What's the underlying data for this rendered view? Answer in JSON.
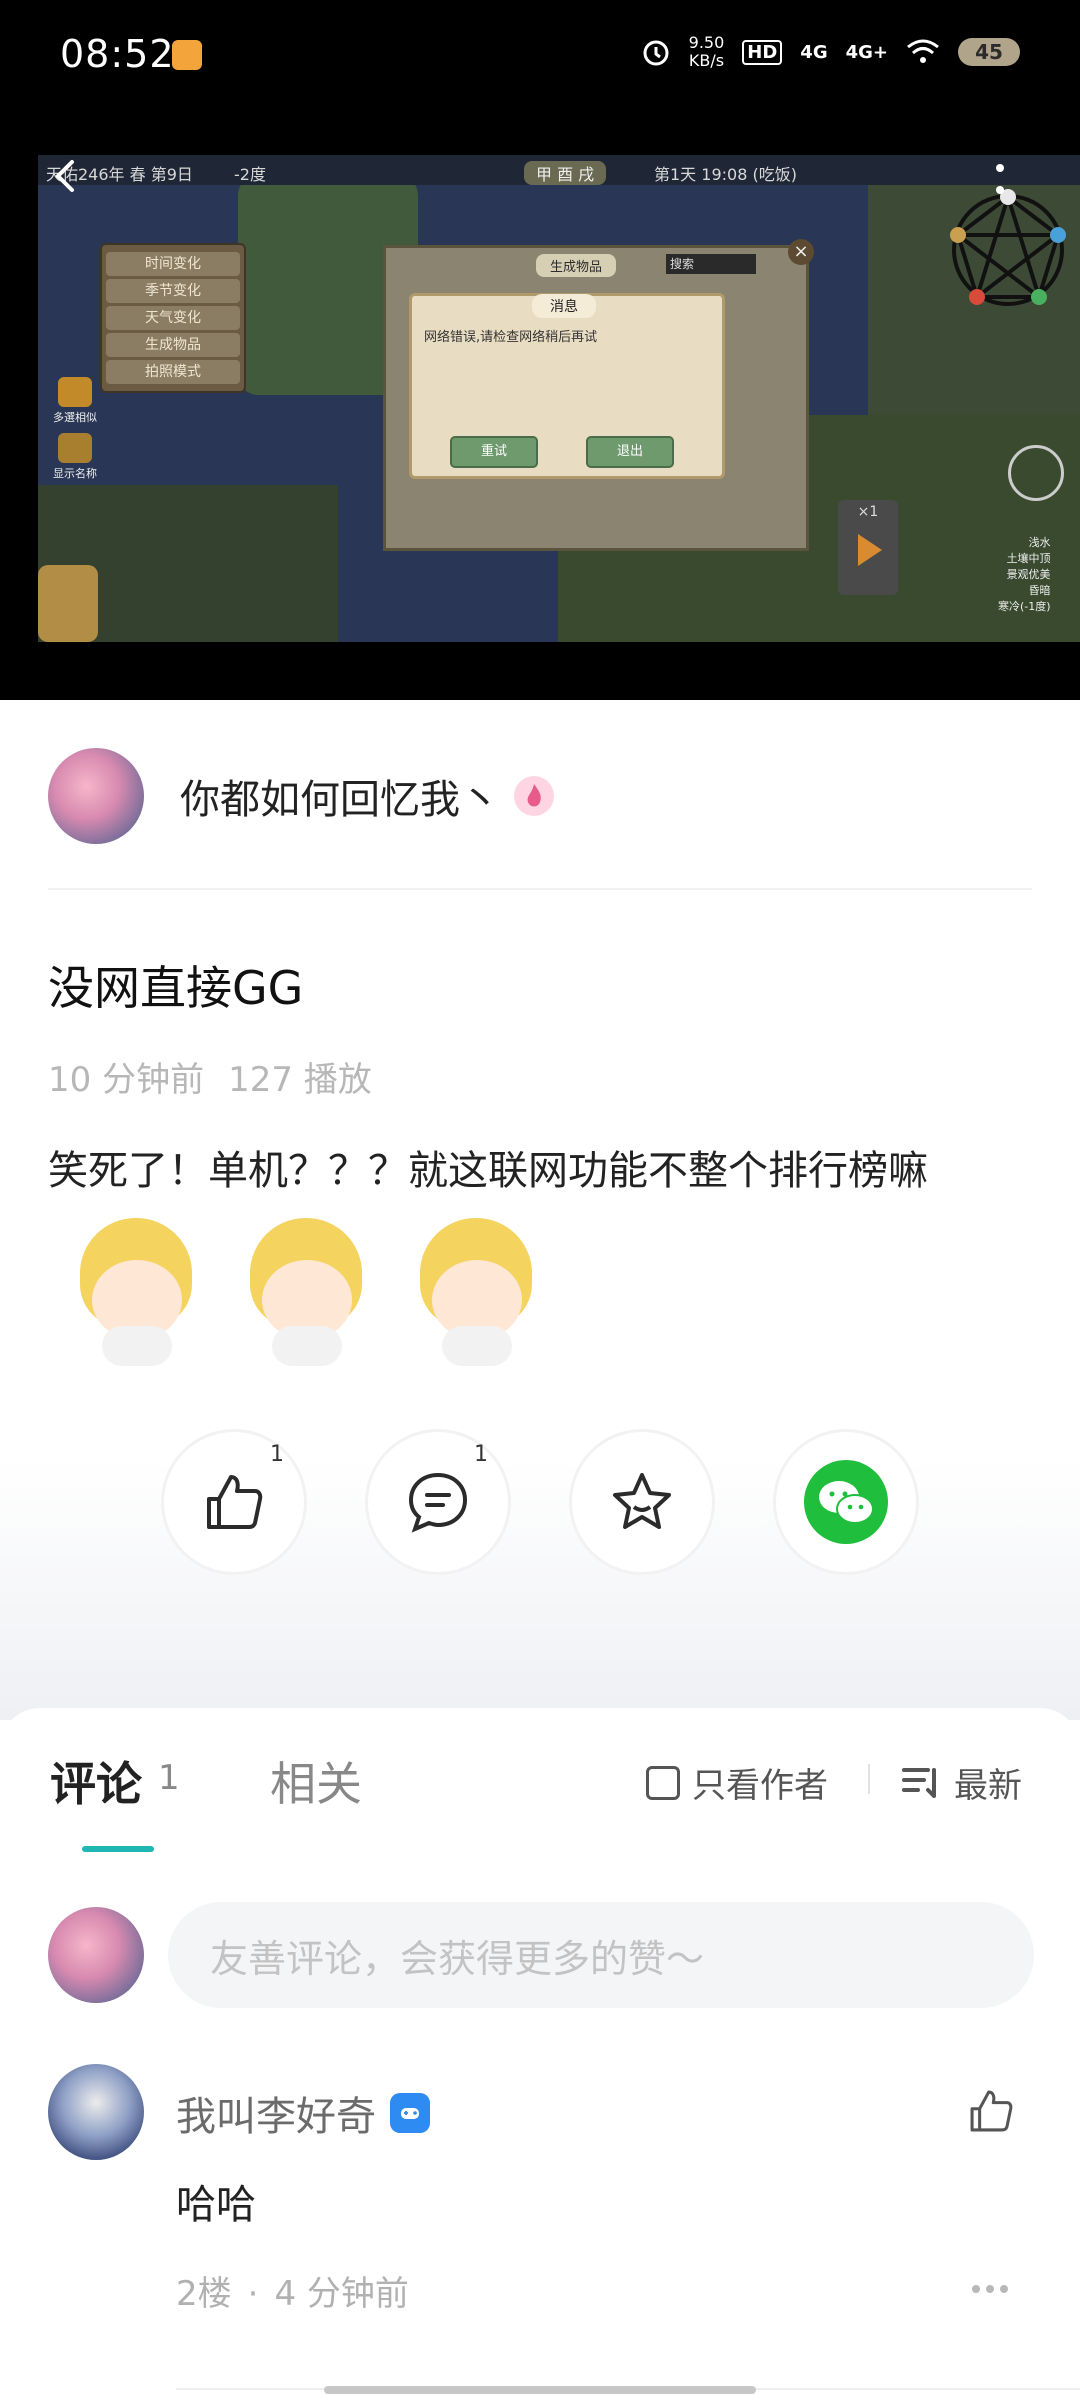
{
  "status_bar": {
    "time": "08:52",
    "net_speed": "9.50",
    "net_unit": "KB/s",
    "hd": "HD",
    "net1": "4G",
    "net2": "4G+",
    "battery": "45"
  },
  "video": {
    "game": {
      "top_left": "天佑246年 春 第9日",
      "temp": "-2度",
      "tag": "甲 酉 戌",
      "day": "第1天 19:08 (吃饭)",
      "menu": [
        "时间变化",
        "季节变化",
        "天气变化",
        "生成物品",
        "拍照模式"
      ],
      "left_icon_1": "多選相似",
      "left_icon_2": "显示名称",
      "panel_title": "生成物品",
      "search": "搜索",
      "dialog_title": "消息",
      "dialog_msg": "网络错误,请检查网络稍后再试",
      "retry": "重试",
      "exit": "退出",
      "speed": "×1",
      "weather": [
        "浅水",
        "土壤中顶",
        "景观优美",
        "昏暗",
        "寒冷(-1度)"
      ]
    }
  },
  "post": {
    "author": "你都如何回忆我丶",
    "title": "没网直接GG",
    "time_ago": "10 分钟前",
    "plays": "127 播放",
    "body": "笑死了！单机？？？就这联网功能不整个排行榜嘛",
    "like_count": "1",
    "comment_count": "1"
  },
  "comments_section": {
    "tab_comment": "评论",
    "tab_comment_count": "1",
    "tab_related": "相关",
    "only_author": "只看作者",
    "sort": "最新",
    "input_placeholder": "友善评论，会获得更多的赞～",
    "items": [
      {
        "name": "我叫李好奇",
        "text": "哈哈",
        "floor": "2楼",
        "time": "4 分钟前"
      }
    ]
  },
  "colors": {
    "accent": "#1fb7b3",
    "wechat": "#1fbe3d"
  }
}
